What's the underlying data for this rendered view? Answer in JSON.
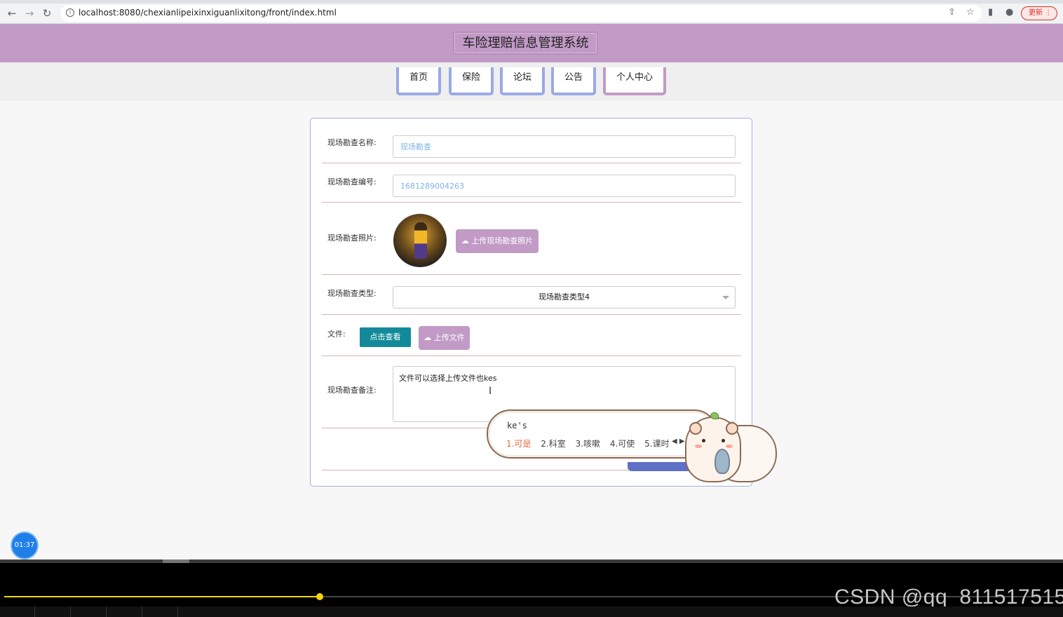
{
  "browser": {
    "url": "localhost:8080/chexianlipeixinxiguanlixitong/front/index.html",
    "update_label": "更新"
  },
  "header": {
    "title": "车险理赔信息管理系统"
  },
  "nav": {
    "items": [
      {
        "label": "首页"
      },
      {
        "label": "保险"
      },
      {
        "label": "论坛"
      },
      {
        "label": "公告"
      },
      {
        "label": "个人中心"
      }
    ]
  },
  "form": {
    "name": {
      "label": "现场勘查名称:",
      "value": "现场勘查"
    },
    "number": {
      "label": "现场勘查编号:",
      "value": "1681289004263"
    },
    "photo": {
      "label": "现场勘查照片:",
      "upload_label": "上传现场勘查照片"
    },
    "type": {
      "label": "现场勘查类型:",
      "value": "现场勘查类型4"
    },
    "file": {
      "label": "文件:",
      "view_label": "点击查看",
      "upload_label": "上传文件"
    },
    "remark": {
      "label": "现场勘查备注:",
      "value": "文件可以选择上传文件也kes"
    }
  },
  "ime": {
    "composition": "ke's",
    "candidates": [
      "1.可是",
      "2.科室",
      "3.咳嗽",
      "4.可使",
      "5.课时"
    ]
  },
  "player": {
    "timer": "01:37",
    "progress": 0.299,
    "watermark": "CSDN @qq_811517515"
  },
  "colors": {
    "header": "#c29ac6",
    "nav_border": "#9aa9e6",
    "teal": "#138a9a",
    "progress": "#f2d600"
  }
}
